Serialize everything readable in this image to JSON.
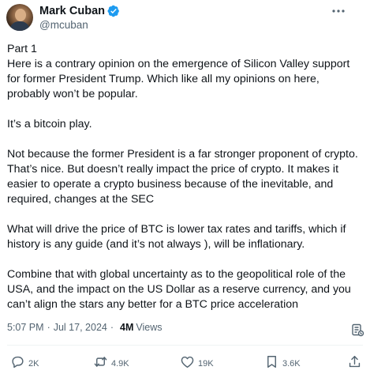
{
  "author": {
    "name": "Mark Cuban",
    "handle": "@mcuban",
    "verified_color": "#1d9bf0"
  },
  "tweet": {
    "paragraphs": [
      "Part 1\nHere is a contrary opinion on the emergence of Silicon Valley support for former President Trump. Which like all my opinions on here, probably won’t be popular.",
      "It’s a bitcoin play.",
      "Not because the former President is a far stronger proponent of crypto. That’s nice. But doesn’t really impact the price of crypto. It makes it easier to operate a crypto business because of the inevitable, and required, changes at the SEC",
      "What will drive the price of BTC is lower tax rates and tariffs, which if history is any guide (and it’s not always ), will be inflationary.",
      "Combine that with global uncertainty as to the geopolitical role of the USA, and the impact on the US Dollar as a reserve currency, and you can’t align the stars any better for a BTC price acceleration"
    ],
    "time": "5:07 PM",
    "date": "Jul 17, 2024",
    "separator": "·",
    "views_count": "4M",
    "views_label": "Views"
  },
  "actions": {
    "replies": "2K",
    "reposts": "4.9K",
    "likes": "19K",
    "bookmarks": "3.6K"
  },
  "icons": {
    "more": "more-horizontal-icon",
    "bookmark_top": "bookmark-slash-icon",
    "reply": "reply-icon",
    "repost": "repost-icon",
    "like": "like-icon",
    "bookmark": "bookmark-icon",
    "share": "share-icon"
  },
  "colors": {
    "text": "#0f1419",
    "secondary": "#536471",
    "divider": "#eff3f4",
    "accent": "#1d9bf0"
  }
}
